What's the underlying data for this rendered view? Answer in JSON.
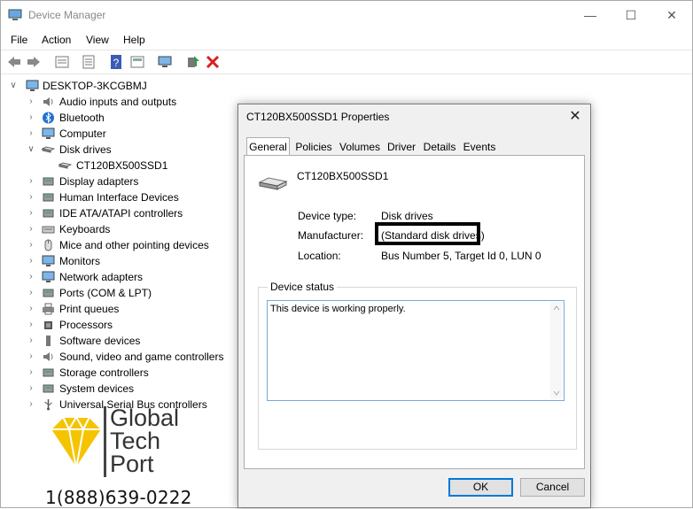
{
  "window": {
    "title": "Device Manager",
    "minimize": "—",
    "maximize": "☐",
    "close": "✕"
  },
  "menu": [
    "File",
    "Action",
    "View",
    "Help"
  ],
  "tree": {
    "root": "DESKTOP-3KCGBMJ",
    "items": [
      {
        "label": "Audio inputs and outputs",
        "icon": "speaker-icon",
        "expanded": false
      },
      {
        "label": "Bluetooth",
        "icon": "bluetooth-icon",
        "expanded": false
      },
      {
        "label": "Computer",
        "icon": "computer-icon",
        "expanded": false
      },
      {
        "label": "Disk drives",
        "icon": "disk-drive-icon",
        "expanded": true
      },
      {
        "label": "CT120BX500SSD1",
        "icon": "disk-drive-icon",
        "child": true
      },
      {
        "label": "Display adapters",
        "icon": "display-adapter-icon",
        "expanded": false
      },
      {
        "label": "Human Interface Devices",
        "icon": "hid-icon",
        "expanded": false
      },
      {
        "label": "IDE ATA/ATAPI controllers",
        "icon": "ide-controller-icon",
        "expanded": false
      },
      {
        "label": "Keyboards",
        "icon": "keyboard-icon",
        "expanded": false
      },
      {
        "label": "Mice and other pointing devices",
        "icon": "mouse-icon",
        "expanded": false
      },
      {
        "label": "Monitors",
        "icon": "monitor-icon",
        "expanded": false
      },
      {
        "label": "Network adapters",
        "icon": "network-adapter-icon",
        "expanded": false
      },
      {
        "label": "Ports (COM & LPT)",
        "icon": "port-icon",
        "expanded": false
      },
      {
        "label": "Print queues",
        "icon": "printer-icon",
        "expanded": false
      },
      {
        "label": "Processors",
        "icon": "processor-icon",
        "expanded": false
      },
      {
        "label": "Software devices",
        "icon": "software-device-icon",
        "expanded": false
      },
      {
        "label": "Sound, video and game controllers",
        "icon": "sound-icon",
        "expanded": false
      },
      {
        "label": "Storage controllers",
        "icon": "storage-controller-icon",
        "expanded": false
      },
      {
        "label": "System devices",
        "icon": "system-device-icon",
        "expanded": false
      },
      {
        "label": "Universal Serial Bus controllers",
        "icon": "usb-icon",
        "expanded": false
      }
    ]
  },
  "watermark": {
    "line1": "Global",
    "line2": "Tech",
    "line3": "Port",
    "phone": "1(888)639-0222"
  },
  "dialog": {
    "title": "CT120BX500SSD1 Properties",
    "close": "✕",
    "tabs": [
      "General",
      "Policies",
      "Volumes",
      "Driver",
      "Details",
      "Events"
    ],
    "active_tab": "General",
    "device_name": "CT120BX500SSD1",
    "device_type_label": "Device type:",
    "device_type_value": "Disk drives",
    "manufacturer_label": "Manufacturer:",
    "manufacturer_value": "(Standard disk drives)",
    "location_label": "Location:",
    "location_value": "Bus Number 5, Target Id 0, LUN 0",
    "status_legend": "Device status",
    "status_text": "This device is working properly.",
    "ok": "OK",
    "cancel": "Cancel"
  },
  "colors": {
    "accent": "#0078d7",
    "gold": "#f2c200",
    "red_x": "#d81f1f"
  }
}
